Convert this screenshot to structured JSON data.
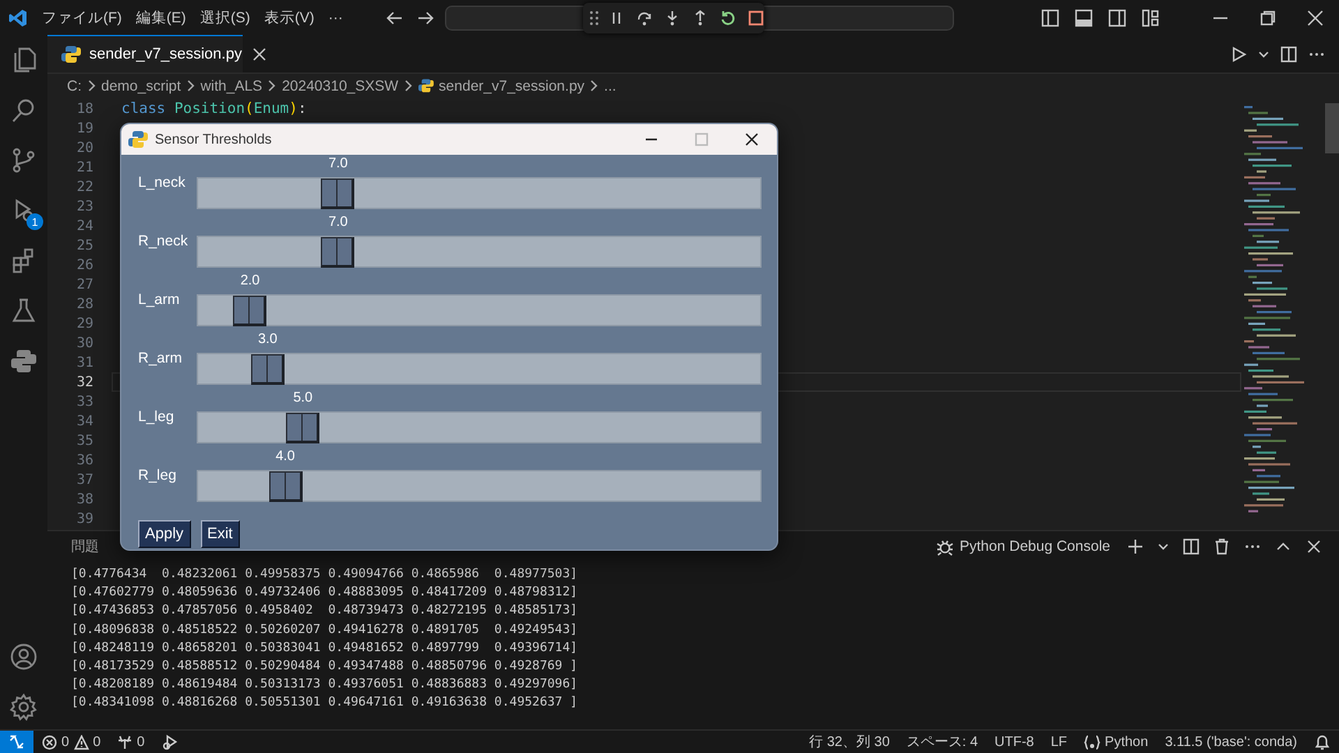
{
  "title_bar": {
    "menu": [
      "ファイル(F)",
      "編集(E)",
      "選択(S)",
      "表示(V)",
      "···"
    ]
  },
  "activity_bar": {
    "run_badge": "1"
  },
  "editor_tab": {
    "label": "sender_v7_session.py",
    "selected": true
  },
  "breadcrumbs": [
    "C:",
    "demo_script",
    "with_ALS",
    "20240310_SXSW",
    "sender_v7_session.py",
    "..."
  ],
  "code_lines": [
    {
      "number": "18",
      "current": false,
      "tokens": [
        {
          "kind": "keyword",
          "text": "class "
        },
        {
          "kind": "type",
          "text": "Position"
        },
        {
          "kind": "bracket",
          "text": "("
        },
        {
          "kind": "type",
          "text": "Enum"
        },
        {
          "kind": "bracket",
          "text": ")"
        },
        {
          "kind": "plain",
          "text": ":"
        }
      ]
    },
    {
      "number": "19",
      "current": false
    },
    {
      "number": "20",
      "current": false
    },
    {
      "number": "21",
      "current": false
    },
    {
      "number": "22",
      "current": false
    },
    {
      "number": "23",
      "current": false
    },
    {
      "number": "24",
      "current": false
    },
    {
      "number": "25",
      "current": false
    },
    {
      "number": "26",
      "current": false
    },
    {
      "number": "27",
      "current": false
    },
    {
      "number": "28",
      "current": false
    },
    {
      "number": "29",
      "current": false
    },
    {
      "number": "30",
      "current": false
    },
    {
      "number": "31",
      "current": false
    },
    {
      "number": "32",
      "current": true
    },
    {
      "number": "33",
      "current": false
    },
    {
      "number": "34",
      "current": false
    },
    {
      "number": "35",
      "current": false
    },
    {
      "number": "36",
      "current": false
    },
    {
      "number": "37",
      "current": false
    },
    {
      "number": "38",
      "current": false
    },
    {
      "number": "39",
      "current": false
    }
  ],
  "dialog": {
    "title": "Sensor Thresholds",
    "sliders": [
      {
        "label": "L_neck",
        "reading": "7.0",
        "level": 0.2333
      },
      {
        "label": "R_neck",
        "reading": "7.0",
        "level": 0.2333
      },
      {
        "label": "L_arm",
        "reading": "2.0",
        "level": 0.0667
      },
      {
        "label": "R_arm",
        "reading": "3.0",
        "level": 0.1
      },
      {
        "label": "L_leg",
        "reading": "5.0",
        "level": 0.1667
      },
      {
        "label": "R_leg",
        "reading": "4.0",
        "level": 0.1333
      }
    ],
    "buttons": [
      "Apply",
      "Exit"
    ]
  },
  "panel": {
    "tabs": [
      {
        "label": "問題",
        "selected": false
      }
    ],
    "console": "Python Debug Console",
    "output": [
      "[0.4776434  0.48232061 0.49958375 0.49094766 0.4865986  0.48977503]",
      "[0.47602779 0.48059636 0.49732406 0.48883095 0.48417209 0.48798312]",
      "[0.47436853 0.47857056 0.4958402  0.48739473 0.48272195 0.48585173]",
      "[0.48096838 0.48518522 0.50260207 0.49416278 0.4891705  0.49249543]",
      "[0.48248119 0.48658201 0.50383041 0.49481652 0.4897799  0.49396714]",
      "[0.48173529 0.48588512 0.50290484 0.49347488 0.48850796 0.4928769 ]",
      "[0.48208189 0.48619484 0.50313173 0.49376051 0.48836883 0.49297096]",
      "[0.48341098 0.48816268 0.50551301 0.49647161 0.49163638 0.4952637 ]"
    ]
  },
  "status_bar": {
    "errors": "0",
    "warnings": "0",
    "ports": "0",
    "cursor": "行 32、列 30",
    "indent": "スペース: 4",
    "encoding": "UTF-8",
    "eol": "LF",
    "language": "Python",
    "interpreter": "3.11.5 ('base': conda)"
  }
}
